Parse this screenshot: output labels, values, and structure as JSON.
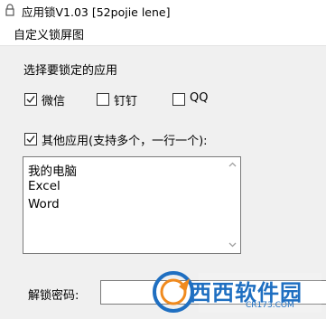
{
  "window": {
    "title": "应用锁V1.03 [52pojie lene]",
    "icon": "lock-icon"
  },
  "menu": {
    "items": [
      {
        "label": "自定义锁屏图"
      }
    ]
  },
  "apps_section": {
    "heading": "选择要锁定的应用",
    "options": [
      {
        "label": "微信",
        "checked": true
      },
      {
        "label": "钉钉",
        "checked": false
      },
      {
        "label": "QQ",
        "checked": false
      }
    ]
  },
  "other_apps": {
    "label": "其他应用(支持多个，一行一个):",
    "checked": true,
    "lines": [
      "我的电脑",
      "Excel",
      "Word"
    ]
  },
  "password": {
    "label": "解锁密码:",
    "value": ""
  },
  "watermark": {
    "brand": "西西软件园",
    "site": "CR173.COM"
  },
  "colors": {
    "window_bg": "#f0f0f0",
    "field_bg": "#ffffff",
    "border": "#7a7a7a",
    "watermark_blue": "#1f6fc1",
    "watermark_orange": "#f08a1e"
  }
}
